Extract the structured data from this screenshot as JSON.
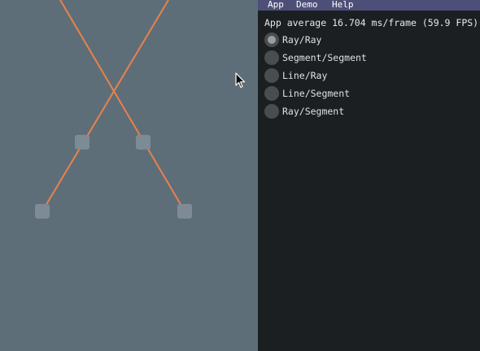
{
  "menubar": {
    "items": [
      "App",
      "Demo",
      "Help"
    ]
  },
  "panel": {
    "fps_text": "App average 16.704 ms/frame (59.9 FPS)",
    "options": [
      {
        "label": "Ray/Ray",
        "selected": true
      },
      {
        "label": "Segment/Segment",
        "selected": false
      },
      {
        "label": "Line/Ray",
        "selected": false
      },
      {
        "label": "Line/Segment",
        "selected": false
      },
      {
        "label": "Ray/Segment",
        "selected": false
      }
    ]
  },
  "colors": {
    "ray": "#e8824a",
    "viewport_bg": "#5e6e79",
    "panel_bg": "#1b1f22",
    "menubar_bg": "#4d4f78"
  },
  "icons": {
    "cursor": "arrow-cursor-icon"
  }
}
